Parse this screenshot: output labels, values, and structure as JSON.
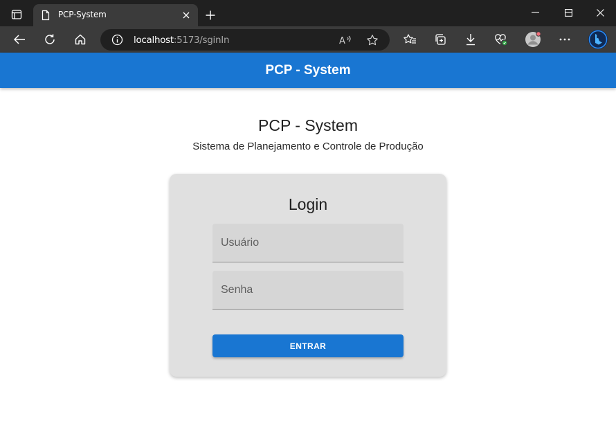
{
  "browser": {
    "tab": {
      "title": "PCP-System"
    },
    "address": {
      "host": "localhost",
      "rest": ":5173/sginIn"
    }
  },
  "app": {
    "header_title": "PCP - System",
    "title": "PCP - System",
    "subtitle": "Sistema de Planejamento e Controle de Produção",
    "login": {
      "title": "Login",
      "username_placeholder": "Usuário",
      "password_placeholder": "Senha",
      "submit_label": "ENTRAR"
    }
  },
  "colors": {
    "primary": "#1976d2",
    "card_bg": "#e0e0e0",
    "field_bg": "#d6d6d6",
    "chrome_dark": "#202020",
    "chrome_mid": "#3b3b3b"
  }
}
